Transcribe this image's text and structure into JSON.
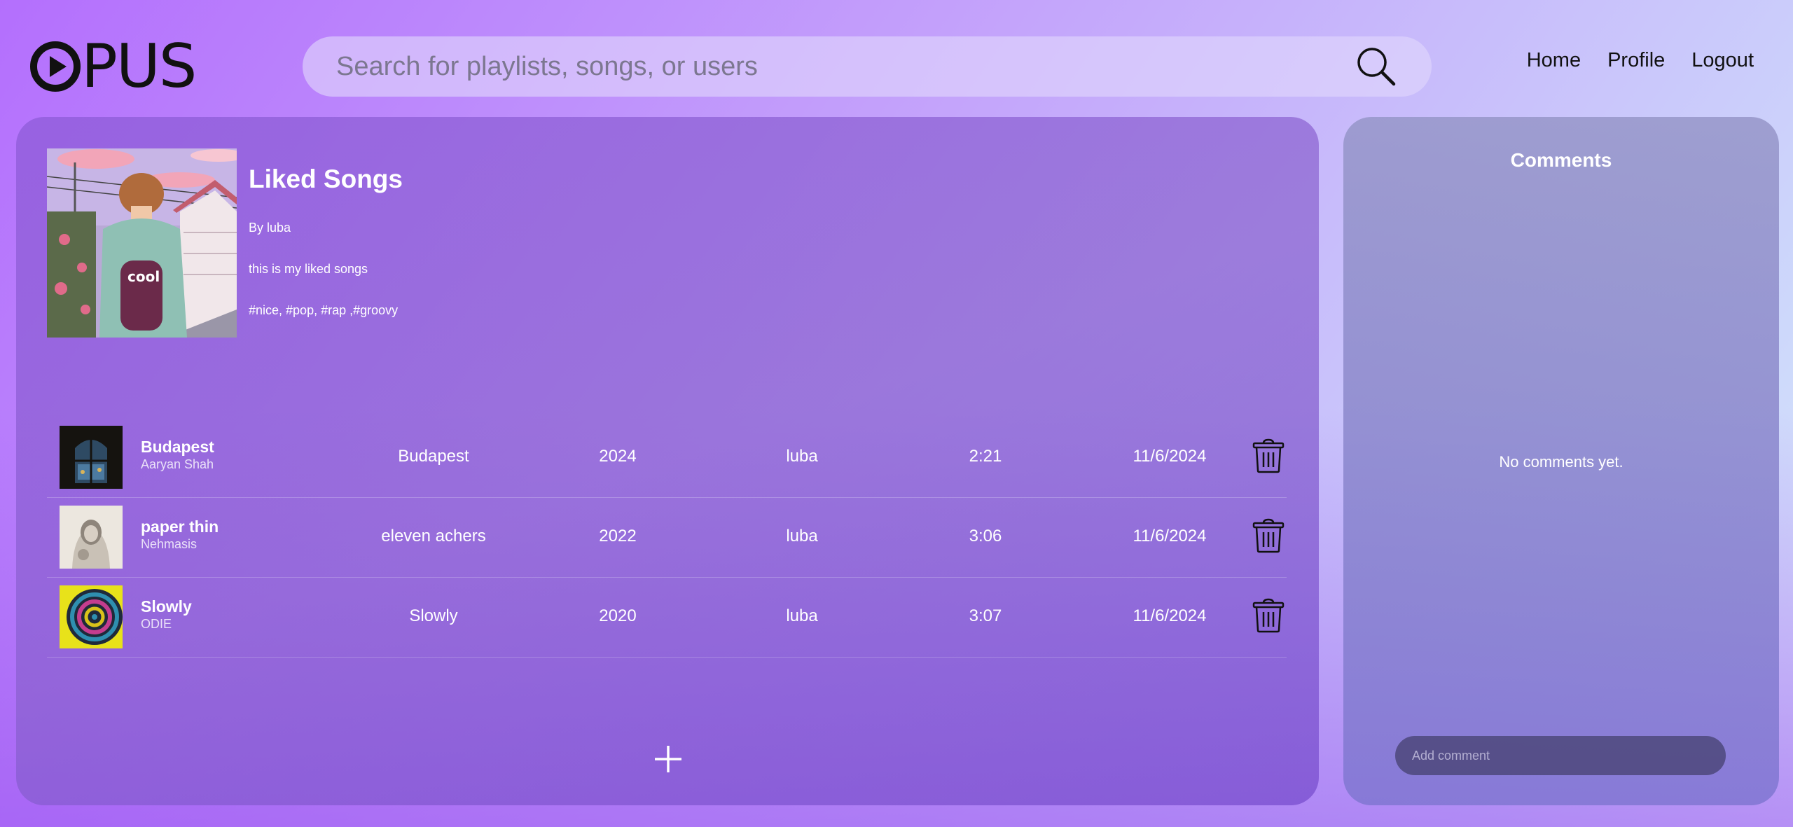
{
  "header": {
    "logo_text": "PUS",
    "search": {
      "placeholder": "Search for playlists, songs, or users",
      "value": ""
    },
    "nav": [
      "Home",
      "Profile",
      "Logout"
    ]
  },
  "playlist": {
    "title": "Liked Songs",
    "by": "By luba",
    "description": "this is my liked songs",
    "tags": "#nice, #pop, #rap ,#groovy"
  },
  "songs": [
    {
      "name": "Budapest",
      "artist": "Aaryan Shah",
      "album": "Budapest",
      "year": "2024",
      "added_by": "luba",
      "duration": "2:21",
      "date": "11/6/2024"
    },
    {
      "name": "paper thin",
      "artist": "Nehmasis",
      "album": "eleven achers",
      "year": "2022",
      "added_by": "luba",
      "duration": "3:06",
      "date": "11/6/2024"
    },
    {
      "name": "Slowly",
      "artist": "ODIE",
      "album": "Slowly",
      "year": "2020",
      "added_by": "luba",
      "duration": "3:07",
      "date": "11/6/2024"
    }
  ],
  "comments": {
    "title": "Comments",
    "empty_text": "No comments yet.",
    "input_placeholder": "Add comment"
  },
  "colors": {
    "accent": "#9b59f5",
    "panel": "#8a62d0",
    "comment_input": "#4b4678"
  }
}
